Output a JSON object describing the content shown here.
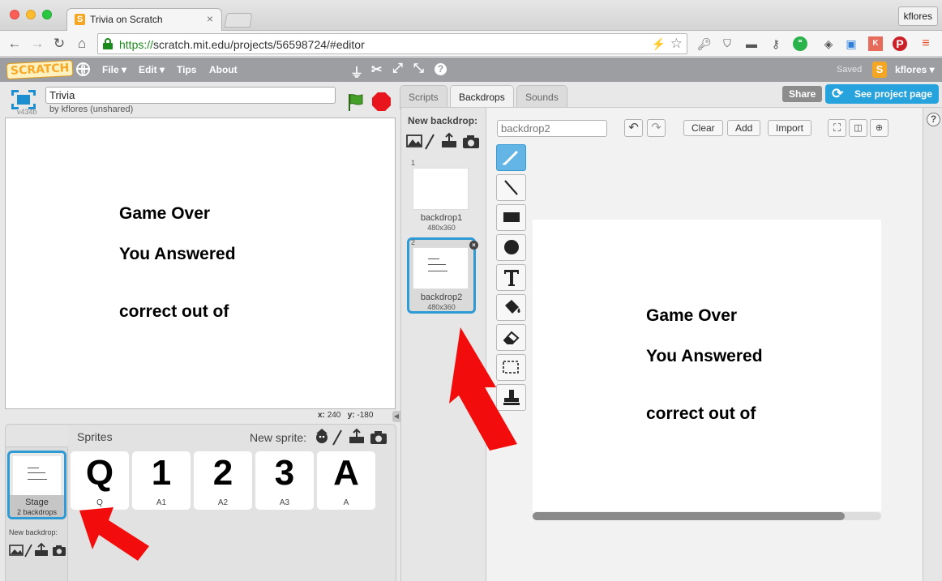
{
  "browser": {
    "tab_title": "Trivia on Scratch",
    "tab_close": "×",
    "profile": "kflores",
    "url_scheme": "https://",
    "url_rest": "scratch.mit.edu/projects/56598724/#editor"
  },
  "menubar": {
    "logo": "SCRATCH",
    "file": "File ▾",
    "edit": "Edit ▾",
    "tips": "Tips",
    "about": "About",
    "saved": "Saved",
    "user_initial": "S",
    "username": "kflores ▾"
  },
  "stage": {
    "version": "v434b",
    "project_title": "Trivia",
    "byline": "by kflores (unshared)",
    "line1": "Game Over",
    "line2": "You Answered",
    "line3": "correct out of",
    "x_label": "x:",
    "x_value": "240",
    "y_label": "y:",
    "y_value": "-180"
  },
  "sprites_pane": {
    "title": "Sprites",
    "new_sprite_label": "New sprite:",
    "stage_label": "Stage",
    "stage_sub": "2 backdrops",
    "new_backdrop_label": "New backdrop:",
    "sprites": [
      {
        "glyph": "Q",
        "name": "Q"
      },
      {
        "glyph": "1",
        "name": "A1"
      },
      {
        "glyph": "2",
        "name": "A2"
      },
      {
        "glyph": "3",
        "name": "A3"
      },
      {
        "glyph": "A",
        "name": "A"
      }
    ]
  },
  "tabs": {
    "scripts": "Scripts",
    "backdrops": "Backdrops",
    "sounds": "Sounds",
    "share": "Share",
    "see_project": "See project page"
  },
  "backdrops": {
    "label": "New backdrop:",
    "items": [
      {
        "num": "1",
        "name": "backdrop1",
        "size": "480x360"
      },
      {
        "num": "2",
        "name": "backdrop2",
        "size": "480x360"
      }
    ]
  },
  "editor": {
    "costume_name": "backdrop2",
    "clear": "Clear",
    "add": "Add",
    "import": "Import",
    "line1": "Game Over",
    "line2": "You Answered",
    "line3": "correct out of"
  },
  "colors": {
    "accent": "#26a2dc",
    "selection": "#2e9bd5",
    "menubar": "#9c9ea2",
    "annotation_arrow": "#f20c0c"
  }
}
